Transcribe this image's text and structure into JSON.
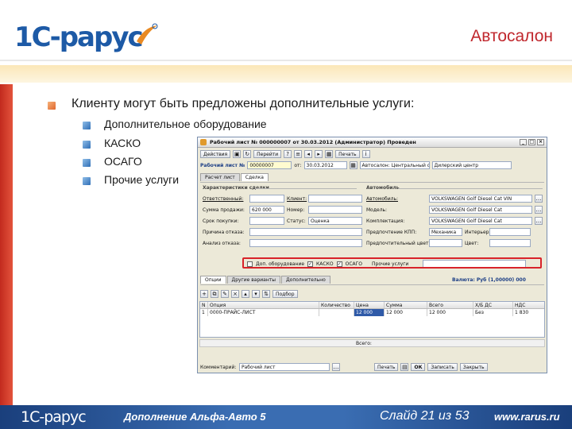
{
  "header": {
    "logo": "1С-рарус",
    "title": "Автосалон"
  },
  "main": {
    "bullet": "Клиенту могут быть предложены дополнительные услуги:",
    "sub_bullets": [
      "Дополнительное оборудование",
      "КАСКО",
      "ОСАГО",
      "Прочие услуги"
    ]
  },
  "app": {
    "title": "Рабочий лист № 000000007 от 30.03.2012 (Администратор) Проведен",
    "toolbar": {
      "actions": "Действия",
      "goto": "Перейти",
      "print": "Печать"
    },
    "doc": {
      "label": "Рабочий лист №",
      "number": "00000007",
      "from": "от:",
      "date": "30.03.2012",
      "org": "Автосалон: Центральный салон",
      "org_value": "Дилерский центр"
    },
    "tabs_top": [
      "Расчет лист",
      "Сделка"
    ],
    "left_section": "Характеристики сделки",
    "right_section": "Автомобиль",
    "fields": {
      "manager_label": "Ответственный:",
      "client_label": "Клиент:",
      "sum_label": "Сумма продажи:",
      "sum_value": "620 000",
      "pay_label": "Номер:",
      "pay_value": "",
      "credit_label": "Срок покупки:",
      "status_label": "Статус:",
      "status_value": "Оценка",
      "reason_label": "Причина отказа:",
      "analysis_label": "Анализ отказа:",
      "auto_label": "Автомобиль:",
      "auto_value": "VOLKSWAGEN Golf Diesel Cat VIN",
      "model_label": "Модель:",
      "model_value": "VOLKSWAGEN Golf Diesel Cat",
      "config_label": "Комплектация:",
      "config_value": "VOLKSWAGEN Golf Diesel Cat",
      "kpp_label": "Предпочтение КПП:",
      "kpp_value": "Механика",
      "interior_label": "Интерьер:",
      "color_label": "Предпочтительный цвет:",
      "color_label2": "Цвет:"
    },
    "services": {
      "equipment": "Доп. оборудование",
      "kasko": "КАСКО",
      "osago": "ОСАГО",
      "other": "Прочие услуги"
    },
    "tabs_bottom": [
      "Опции",
      "Другие варианты",
      "Дополнительно"
    ],
    "total_label": "Валюта: Руб (1,00000) 000",
    "grid": {
      "pick_btn": "Подбор",
      "columns": [
        "N",
        "Опция",
        "Количество",
        "Цена",
        "Сумма",
        "Всего",
        "Х/Б ДС",
        "НДС"
      ],
      "row": [
        "1",
        "0000-ПРАЙС-ЛИСТ",
        "",
        "12 000",
        "12 000",
        "12 000",
        "Без",
        "1 830"
      ],
      "footer": "Всего:"
    },
    "bottom": {
      "comment_label": "Комментарий:",
      "comment_value": "Рабочий лист",
      "print": "Печать",
      "ok": "ОК",
      "save": "Записать",
      "close": "Закрыть"
    }
  },
  "footer": {
    "logo": "1С-рарус",
    "product": "Дополнение Альфа-Авто 5",
    "slide": "Слайд 21 из 53",
    "url": "www.rarus.ru"
  },
  "colors": {
    "brand_blue": "#1d5aa6",
    "brand_red": "#c0272d",
    "highlight": "#d8232a"
  }
}
